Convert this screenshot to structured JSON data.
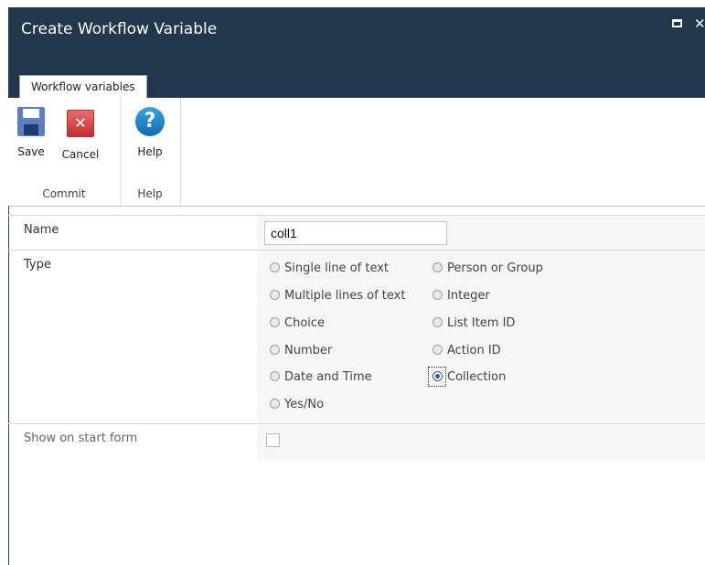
{
  "window": {
    "title": "Create Workflow Variable"
  },
  "tabs": [
    {
      "label": "Workflow variables"
    }
  ],
  "ribbon": {
    "groups": [
      {
        "label": "Commit",
        "buttons": [
          {
            "label": "Save",
            "icon": "floppy-disk-icon"
          },
          {
            "label": "Cancel",
            "icon": "cancel-x-icon"
          }
        ]
      },
      {
        "label": "Help",
        "buttons": [
          {
            "label": "Help",
            "icon": "help-question-icon"
          }
        ]
      }
    ]
  },
  "form": {
    "name": {
      "label": "Name",
      "value": "coll1"
    },
    "type": {
      "label": "Type",
      "options": [
        "Single line of text",
        "Person or Group",
        "Multiple lines of text",
        "Integer",
        "Choice",
        "List Item ID",
        "Number",
        "Action ID",
        "Date and Time",
        "Collection",
        "Yes/No"
      ],
      "selected": "Collection"
    },
    "start_form": {
      "label": "Show on start form",
      "checked": false
    }
  },
  "colors": {
    "titlebar": "#21374c",
    "accent": "#1a5ea8"
  }
}
